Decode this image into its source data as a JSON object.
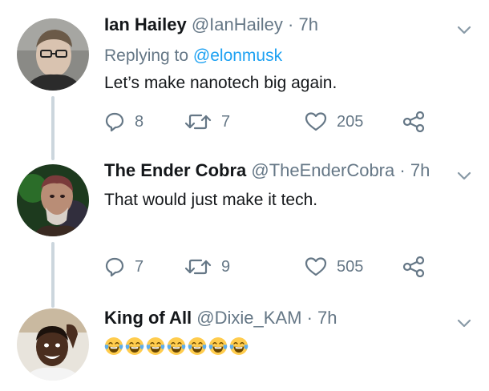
{
  "colors": {
    "name": "#14171a",
    "muted": "#657786",
    "link": "#1da1f2",
    "thread_line": "#ccd6dd",
    "emoji_face": "#ffcc4d",
    "emoji_tear": "#5dadec"
  },
  "tweets": [
    {
      "name": "Ian Hailey",
      "handle": "@IanHailey",
      "dot": "·",
      "time": "7h",
      "replying_prefix": "Replying to ",
      "replying_to": "@elonmusk",
      "text": "Let’s make nanotech big again.",
      "reply_count": "8",
      "retweet_count": "7",
      "like_count": "205"
    },
    {
      "name": "The Ender Cobra",
      "handle": "@TheEnderCobra",
      "dot": "·",
      "time": "7h",
      "text": "That would just make it tech.",
      "reply_count": "7",
      "retweet_count": "9",
      "like_count": "505"
    },
    {
      "name": "King of All",
      "handle": "@Dixie_KAM",
      "dot": "·",
      "time": "7h",
      "emoji": "tears-of-joy-emoji",
      "emoji_count": 7
    }
  ],
  "icons": {
    "reply": "reply-icon",
    "retweet": "retweet-icon",
    "like": "heart-icon",
    "share": "share-icon",
    "menu": "chevron-down-icon"
  }
}
